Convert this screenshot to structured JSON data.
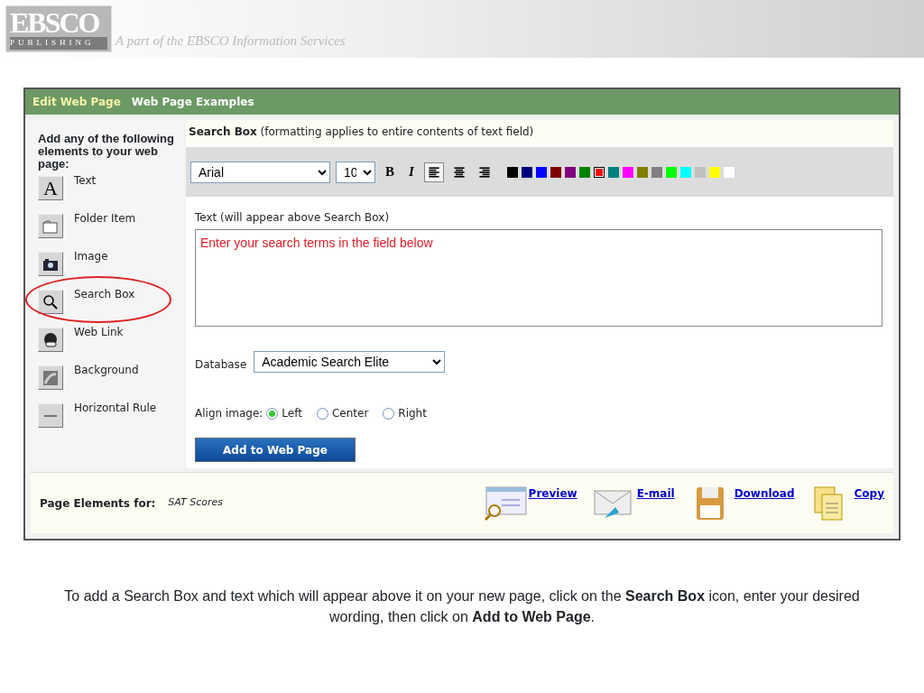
{
  "banner": {
    "logo_top": "EBSCO",
    "logo_bottom": "PUBLISHING",
    "tagline": "A part of the EBSCO Information Services"
  },
  "tabs": [
    {
      "label": "Edit Web Page",
      "selected": true
    },
    {
      "label": "Web Page Examples",
      "selected": false
    }
  ],
  "sidebar": {
    "heading": "Add any of the following elements to your web page:",
    "items": [
      {
        "kind": "text",
        "glyph": "A",
        "label": "Text",
        "circled": false
      },
      {
        "kind": "folder",
        "label": "Folder Item",
        "circled": false
      },
      {
        "kind": "image",
        "label": "Image",
        "circled": false
      },
      {
        "kind": "search",
        "label": "Search Box",
        "circled": true
      },
      {
        "kind": "link",
        "label": "Web Link",
        "circled": false
      },
      {
        "kind": "background",
        "label": "Background",
        "circled": false
      },
      {
        "kind": "rule",
        "label": "Horizontal Rule",
        "circled": false
      }
    ]
  },
  "editor": {
    "title": "**Search Box** (formatting applies to entire contents of text field)",
    "toolbar": {
      "font": "Arial",
      "size": "10",
      "bold_label": "B",
      "italic_label": "I",
      "align": [
        {
          "kind": "left",
          "selected": true
        },
        {
          "kind": "center",
          "selected": false
        },
        {
          "kind": "right",
          "selected": false
        }
      ],
      "colors": [
        {
          "color": "#000000",
          "selected": false
        },
        {
          "color": "#000080",
          "selected": false
        },
        {
          "color": "#0000ff",
          "selected": false
        },
        {
          "color": "#800000",
          "selected": false
        },
        {
          "color": "#800080",
          "selected": false
        },
        {
          "color": "#008000",
          "selected": false
        },
        {
          "color": "#ff0000",
          "selected": true
        },
        {
          "color": "#008080",
          "selected": false
        },
        {
          "color": "#ff00ff",
          "selected": false
        },
        {
          "color": "#808000",
          "selected": false
        },
        {
          "color": "#808080",
          "selected": false
        },
        {
          "color": "#00ff00",
          "selected": false
        },
        {
          "color": "#00ffff",
          "selected": false
        },
        {
          "color": "#c0c0c0",
          "selected": false
        },
        {
          "color": "#ffff00",
          "selected": false
        },
        {
          "color": "#ffffff",
          "selected": false
        }
      ]
    },
    "text_label": "Text (will appear above Search Box)",
    "text_value": "Enter your search terms in the field below",
    "database_label": "Database",
    "database_value": "Academic Search Elite",
    "align_label": "Align image:",
    "align_options": [
      {
        "label": "Left",
        "selected": true
      },
      {
        "label": "Center",
        "selected": false
      },
      {
        "label": "Right",
        "selected": false
      }
    ],
    "submit": "Add to Web Page"
  },
  "footer": {
    "label": "Page Elements for:",
    "value": "SAT Scores",
    "actions": [
      {
        "kind": "preview",
        "label": "Preview"
      },
      {
        "kind": "email",
        "label": "E-mail"
      },
      {
        "kind": "download",
        "label": "Download"
      },
      {
        "kind": "copy",
        "label": "Copy"
      }
    ]
  },
  "caption": "To add a Search Box and text which will appear above it on your new page, click on the **Search Box** icon, enter your desired wording, then click on **Add to Web Page**."
}
